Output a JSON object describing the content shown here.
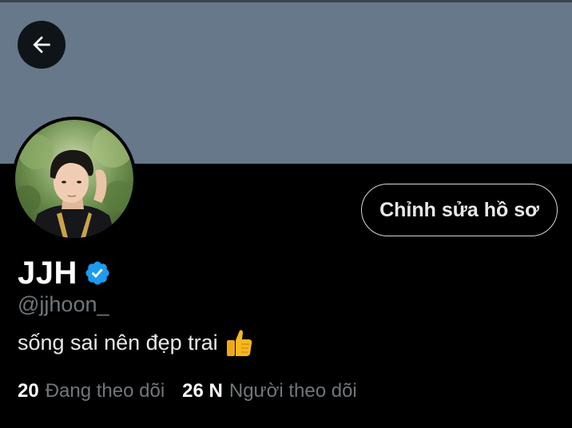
{
  "profile": {
    "display_name": "JJH",
    "handle": "@jjhoon_",
    "bio": "sống sai nên đẹp trai",
    "verified": true,
    "avatar_icon": "profile-photo",
    "bio_emoji_icon": "thumbs-up-icon"
  },
  "header": {
    "back_icon": "arrow-left-icon"
  },
  "actions": {
    "edit_profile_label": "Chỉnh sửa hồ sơ"
  },
  "stats": {
    "following_count": "20",
    "following_label": "Đang theo dõi",
    "followers_count": "26 N",
    "followers_label": "Người theo dõi"
  },
  "colors": {
    "background": "#000000",
    "banner": "#66788a",
    "verified_blue": "#1d9bf0",
    "secondary_text": "#71767b",
    "button_border": "#cfd9de"
  }
}
